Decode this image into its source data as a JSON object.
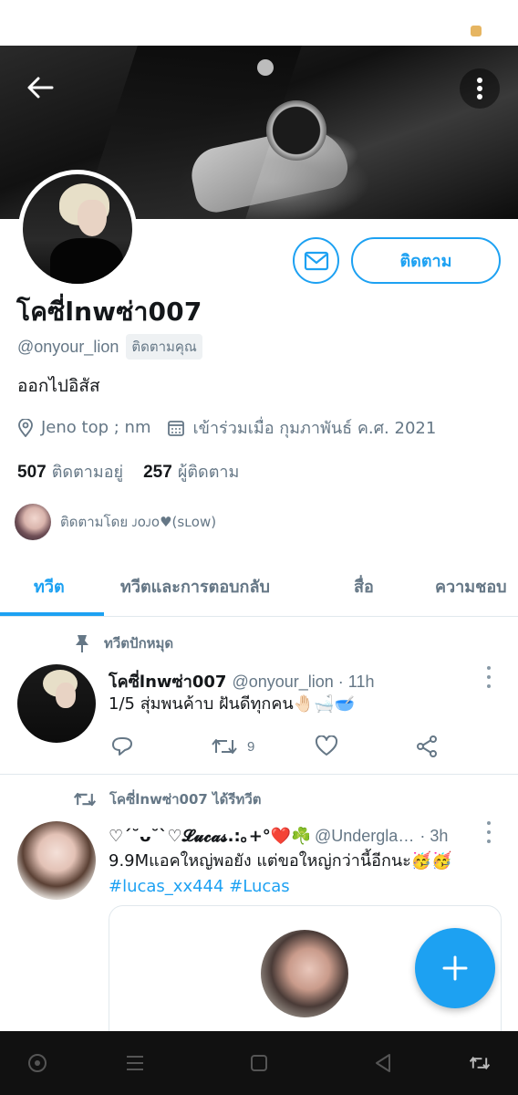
{
  "header": {
    "back_icon": "arrow-left-icon",
    "more_icon": "vertical-dots-icon"
  },
  "profile": {
    "display_name": "โคซี่lnwซ่า007",
    "handle": "@onyour_lion",
    "follows_you": "ติดตามคุณ",
    "bio": "ออกไปอิสัส",
    "location": "Jeno top ; nm",
    "joined": "เข้าร่วมเมื่อ กุมภาพันธ์ ค.ศ. 2021",
    "following_count": "507",
    "following_label": "ติดตามอยู่",
    "followers_count": "257",
    "followers_label": "ผู้ติดตาม",
    "followed_by": "ติดตามโดย ᴊᴏᴊᴏ♥(sʟᴏᴡ)",
    "follow_button": "ติดตาม",
    "accent_color": "#1da1f2"
  },
  "tabs": [
    {
      "label": "ทวีต",
      "active": true
    },
    {
      "label": "ทวีตและการตอบกลับ",
      "active": false
    },
    {
      "label": "สื่อ",
      "active": false
    },
    {
      "label": "ความชอบ",
      "active": false
    }
  ],
  "tweets": [
    {
      "context": "ทวีตปักหมุด",
      "display_name": "โคซี่lnwซ่า007",
      "handle_time": "@onyour_lion · 11h",
      "text": "1/5 สุ่มพนค้าบ ฝันดีทุกคน🤚🏻🛁🥣",
      "retweets": "9"
    },
    {
      "context": "โคซี่lnwซ่า007 ได้รีทวีต",
      "display_name": "♡ˊ˘ᴗ˘ˋ♡𝓛𝓾𝓬𝓪𝓼.:｡+°❤️☘️",
      "handle": "@Undergla…",
      "time": "· 3h",
      "text": "9.9Mแอคใหญ่พอยัง แต่ขอใหญ่กว่านี้อีกนะ🥳🥳",
      "hashtags": "#lucas_xx444 #Lucas"
    }
  ],
  "fab": {
    "icon": "plus-icon"
  },
  "nav": [
    "circle-icon",
    "menu-icon",
    "square-icon",
    "back-triangle-icon",
    "switch-icon"
  ]
}
